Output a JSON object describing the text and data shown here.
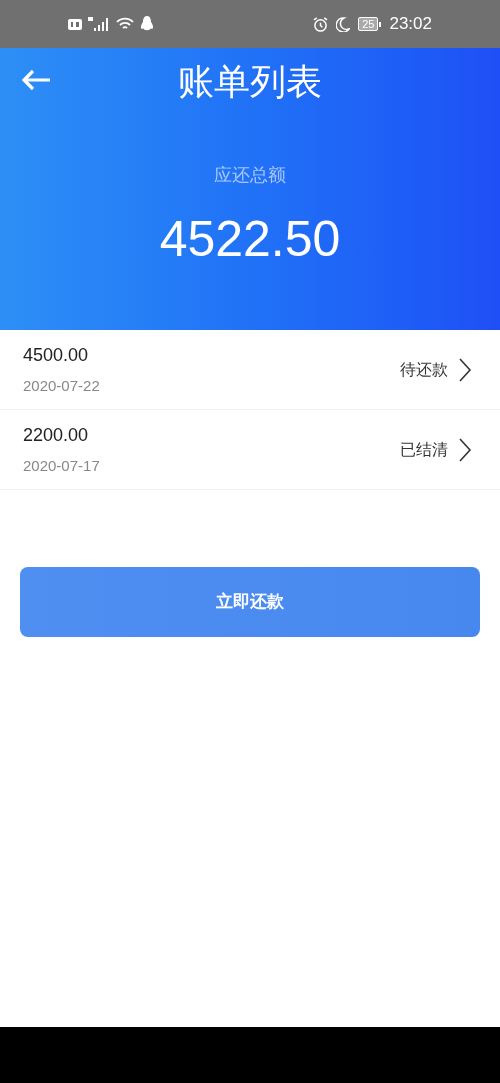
{
  "status_bar": {
    "battery": "25",
    "time": "23:02"
  },
  "header": {
    "title": "账单列表",
    "total_label": "应还总额",
    "total_amount": "4522.50"
  },
  "bills": [
    {
      "amount": "4500.00",
      "date": "2020-07-22",
      "status": "待还款"
    },
    {
      "amount": "2200.00",
      "date": "2020-07-17",
      "status": "已结清"
    }
  ],
  "repay_button": "立即还款"
}
